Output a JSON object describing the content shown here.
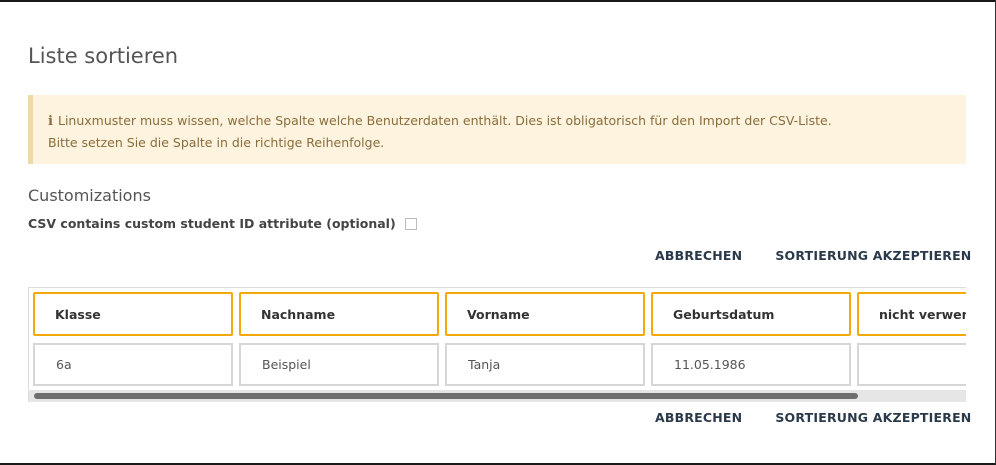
{
  "dialog": {
    "title": "Liste sortieren"
  },
  "alert": {
    "icon": "info-icon",
    "line1": "Linuxmuster muss wissen, welche Spalte welche Benutzerdaten enthält. Dies ist obligatorisch für den Import der CSV-Liste.",
    "line2": "Bitte setzen Sie die Spalte in die richtige Reihenfolge."
  },
  "customizations": {
    "title": "Customizations",
    "custom_id_label": "CSV contains custom student ID attribute (optional)",
    "custom_id_checked": false
  },
  "actions": {
    "cancel_label": "ABBRECHEN",
    "accept_label": "SORTIERUNG AKZEPTIEREN"
  },
  "columns": [
    {
      "header": "Klasse",
      "value": "6a"
    },
    {
      "header": "Nachname",
      "value": "Beispiel"
    },
    {
      "header": "Vorname",
      "value": "Tanja"
    },
    {
      "header": "Geburtsdatum",
      "value": "11.05.1986"
    },
    {
      "header": "nicht verwendet",
      "value": ""
    }
  ],
  "colors": {
    "header_border": "#f5a80a",
    "alert_background": "#fdf3df",
    "alert_text": "#8a6d3b"
  }
}
